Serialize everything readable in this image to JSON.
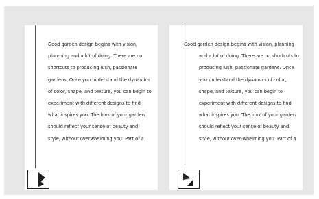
{
  "pages": [
    {
      "lines": [
        "Good garden design begins with vision,",
        "plan-ning and a lot of doing. There are no",
        "shortcuts to producing lush, passionate",
        "gardens. Once you understand the dynamics",
        "of color, shape, and texture, you can begin to",
        "experiment with different designs to find",
        "what inspires you. The look of your garden",
        "should reflect your sense of beauty and",
        "style, without overwhelming you. Part of a"
      ],
      "marker_icon": "arrow-pointer-icon"
    },
    {
      "lines": [
        "Good garden design begins with vision, planning",
        "and a lot of doing. There are no shortcuts to",
        "producing lush, passionate gardens. Once",
        "you understand the dynamics of color,",
        "shape, and texture, you can begin to",
        "experiment with different designs to find",
        "what inspires you. The look of your garden",
        "should reflect your sense of beauty and",
        "style, without over-whelming you. Part of a"
      ],
      "marker_icon": "hanging-indent-icon"
    }
  ],
  "colors": {
    "guide": "#c2177e",
    "canvas": "#e6e7e8",
    "text": "#231f20"
  }
}
